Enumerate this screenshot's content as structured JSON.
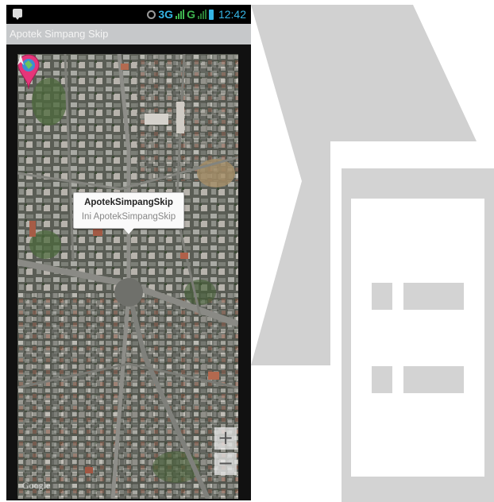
{
  "status_bar": {
    "network_label": "3G",
    "network_label_2": "G",
    "time": "12:42",
    "icons": [
      "message-icon",
      "alarm-icon",
      "signal-icon",
      "signal-icon",
      "battery-icon"
    ]
  },
  "app": {
    "title": "Apotek Simpang Skip"
  },
  "map": {
    "callout": {
      "title": "ApotekSimpangSkip",
      "subtitle": "Ini ApotekSimpangSkip"
    },
    "zoom_in_label": "+",
    "zoom_out_label": "−",
    "attribution": "Google"
  },
  "colors": {
    "status_accent": "#35b5e5",
    "action_bar": "#c6c8ca",
    "marker": "#e6357a",
    "graphic_gray": "#d4d4d4"
  }
}
